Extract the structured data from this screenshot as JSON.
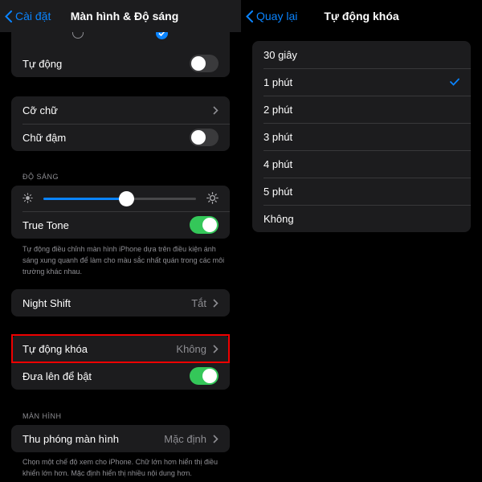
{
  "left": {
    "nav": {
      "back_label": "Cài đặt",
      "title": "Màn hình & Độ sáng"
    },
    "auto_row": {
      "label": "Tự động",
      "toggle_on": false
    },
    "text_card": {
      "text_size": "Cỡ chữ",
      "bold_text": "Chữ đậm",
      "bold_on": false
    },
    "brightness": {
      "header": "ĐỘ SÁNG",
      "level": 0.54,
      "true_tone_label": "True Tone",
      "true_tone_on": true,
      "note": "Tự động điều chỉnh màn hình iPhone dựa trên điều kiện ánh sáng xung quanh để làm cho màu sắc nhất quán trong các môi trường khác nhau."
    },
    "night_shift": {
      "label": "Night Shift",
      "value": "Tắt"
    },
    "lock_card": {
      "auto_lock_label": "Tự động khóa",
      "auto_lock_value": "Không",
      "raise_to_wake_label": "Đưa lên để bật",
      "raise_to_wake_on": true
    },
    "display": {
      "header": "MÀN HÌNH",
      "zoom_label": "Thu phóng màn hình",
      "zoom_value": "Mặc định",
      "note": "Chọn một chế độ xem cho iPhone. Chữ lớn hơn hiển thị điều khiển lớn hơn. Mặc định hiển thị nhiều nội dung hơn."
    }
  },
  "right": {
    "nav": {
      "back_label": "Quay lại",
      "title": "Tự động khóa"
    },
    "options": [
      {
        "label": "30 giây",
        "selected": false
      },
      {
        "label": "1 phút",
        "selected": true
      },
      {
        "label": "2 phút",
        "selected": false
      },
      {
        "label": "3 phút",
        "selected": false
      },
      {
        "label": "4 phút",
        "selected": false
      },
      {
        "label": "5 phút",
        "selected": false
      },
      {
        "label": "Không",
        "selected": false
      }
    ]
  },
  "colors": {
    "accent": "#0a84ff",
    "toggle_on": "#34c759",
    "card": "#1c1c1e",
    "highlight": "#e00000"
  }
}
